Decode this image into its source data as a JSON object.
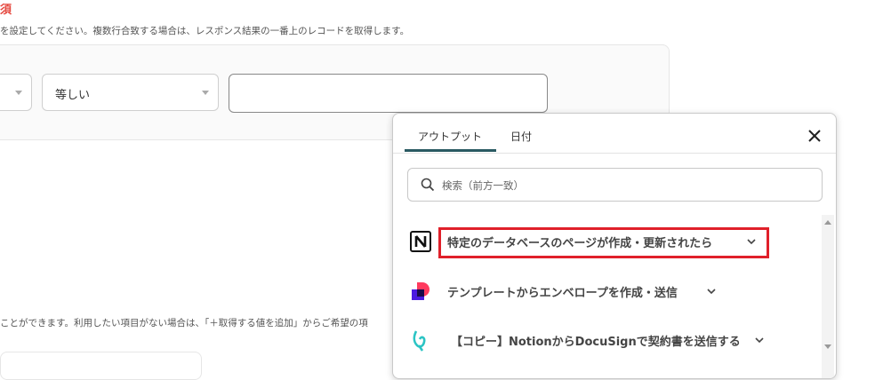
{
  "form": {
    "required_label": "須",
    "instruction": "を設定してください。複数行合致する場合は、レスポンス結果の一番上のレコードを取得します。",
    "operator_select": {
      "value": "等しい"
    },
    "note": "ことができます。利用したい項目がない場合は、「＋取得する値を追加」からご希望の項"
  },
  "popup": {
    "tabs": [
      {
        "label": "アウトプット",
        "active": true
      },
      {
        "label": "日付",
        "active": false
      }
    ],
    "search": {
      "placeholder": "検索（前方一致）"
    },
    "items": [
      {
        "icon": "notion-icon",
        "label": "特定のデータベースのページが作成・更新されたら",
        "highlighted": true
      },
      {
        "icon": "docusign-icon",
        "label": "テンプレートからエンベロープを作成・送信",
        "highlighted": false
      },
      {
        "icon": "yoom-icon",
        "label": "【コピー】NotionからDocuSignで契約書を送信する",
        "highlighted": false
      }
    ]
  },
  "colors": {
    "required": "#e5483f",
    "tab_underline": "#2a5a62",
    "highlight": "#e0202a"
  }
}
